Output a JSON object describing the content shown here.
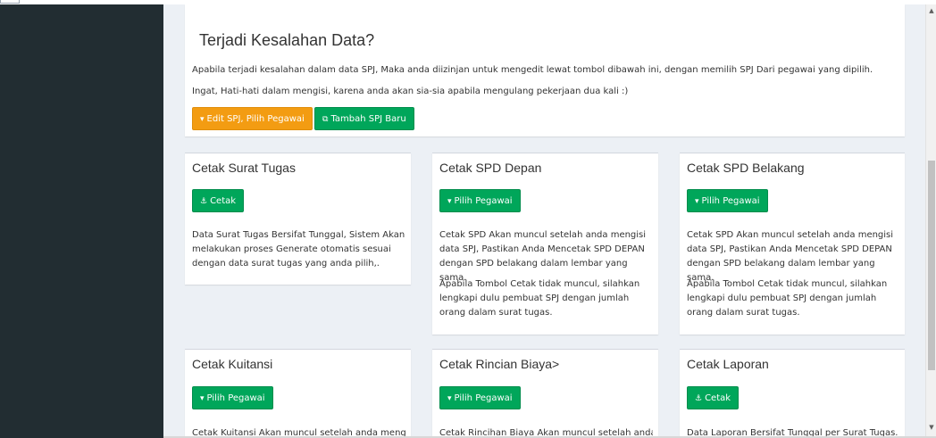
{
  "alert": {
    "title": "Terjadi Kesalahan Data?",
    "line1": "Apabila terjadi kesalahan dalam data SPJ, Maka anda diizinjan untuk mengedit lewat tombol dibawah ini, dengan memilih SPJ Dari pegawai yang dipilih.",
    "line2": "Ingat, Hati-hati dalam mengisi, karena anda akan sia-sia apabila mengulang pekerjaan dua kali :)",
    "edit_button": "Edit SPJ, Pilih Pegawai",
    "add_button": "Tambah SPJ Baru"
  },
  "cards": [
    {
      "title": "Cetak Surat Tugas",
      "button": "Cetak",
      "button_icon": "anchor-icon",
      "text1": "Data Surat Tugas Bersifat Tunggal, Sistem Akan melakukan proses Generate otomatis sesuai dengan data surat tugas yang anda pilih,.",
      "text2": ""
    },
    {
      "title": "Cetak SPD Depan",
      "button": "Pilih Pegawai",
      "button_icon": "caret-down-icon",
      "text1": "Cetak SPD Akan muncul setelah anda mengisi data SPJ, Pastikan Anda Mencetak SPD DEPAN dengan SPD belakang dalam lembar yang sama.",
      "text2": "Apabila Tombol Cetak tidak muncul, silahkan lengkapi dulu pembuat SPJ dengan jumlah orang dalam surat tugas."
    },
    {
      "title": "Cetak SPD Belakang",
      "button": "Pilih Pegawai",
      "button_icon": "caret-down-icon",
      "text1": "Cetak SPD Akan muncul setelah anda mengisi data SPJ, Pastikan Anda Mencetak SPD DEPAN dengan SPD belakang dalam lembar yang sama.",
      "text2": "Apabila Tombol Cetak tidak muncul, silahkan lengkapi dulu pembuat SPJ dengan jumlah orang dalam surat tugas."
    },
    {
      "title": "Cetak Kuitansi",
      "button": "Pilih Pegawai",
      "button_icon": "caret-down-icon",
      "text1": "Cetak Kuitansi Akan muncul setelah anda mengisi",
      "text2": ""
    },
    {
      "title": "Cetak Rincian Biaya>",
      "button": "Pilih Pegawai",
      "button_icon": "caret-down-icon",
      "text1": "Cetak Rincihan Biaya Akan muncul setelah anda",
      "text2": ""
    },
    {
      "title": "Cetak Laporan",
      "button": "Cetak",
      "button_icon": "anchor-icon",
      "text1": "Data Laporan Bersifat Tunggal per Surat Tugas.",
      "text2": ""
    }
  ],
  "colors": {
    "sidebar": "#222d32",
    "content_bg": "#ecf0f5",
    "warning": "#f39c12",
    "success": "#00a65a"
  }
}
